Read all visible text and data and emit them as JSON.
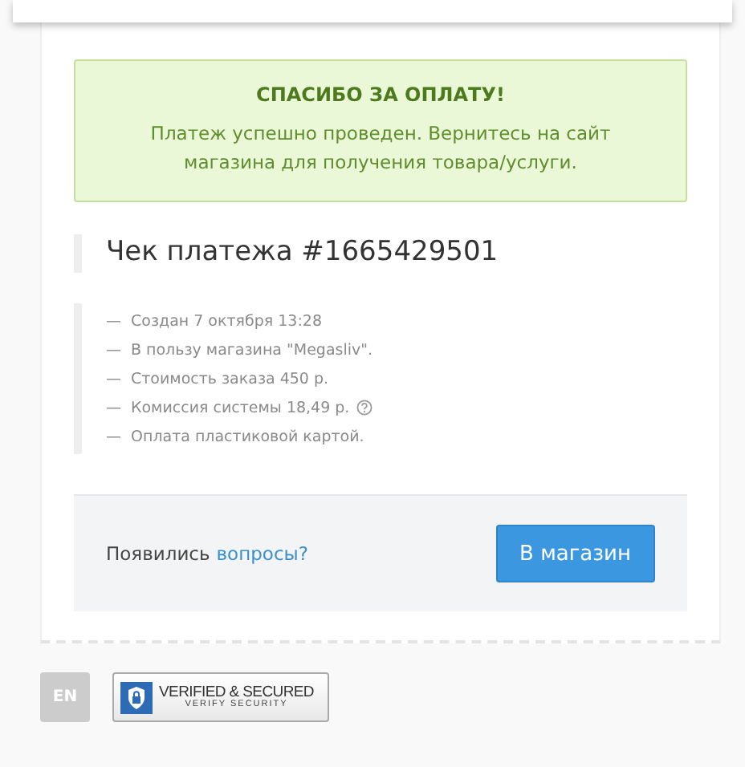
{
  "success": {
    "title": "СПАСИБО ЗА ОПЛАТУ!",
    "message": "Платеж успешно проведен. Вернитесь на сайт магазина для получения товара/услуги."
  },
  "receipt_title": "Чек платежа #1665429501",
  "details": [
    {
      "dash": "—",
      "text": "Создан 7 октября 13:28",
      "help": false
    },
    {
      "dash": "—",
      "text": "В пользу магазина \"Megasliv\".",
      "help": false
    },
    {
      "dash": "—",
      "text": "Стоимость заказа 450 р.",
      "help": false
    },
    {
      "dash": "—",
      "text": "Комиссия системы 18,49 р.",
      "help": true
    },
    {
      "dash": "—",
      "text": "Оплата пластиковой картой.",
      "help": false
    }
  ],
  "footer": {
    "question": "Появились",
    "link": "вопросы?",
    "button": "В магазин"
  },
  "language": "EN",
  "badge": {
    "title": "VERIFIED & SECURED",
    "subtitle": "VERIFY SECURITY"
  }
}
